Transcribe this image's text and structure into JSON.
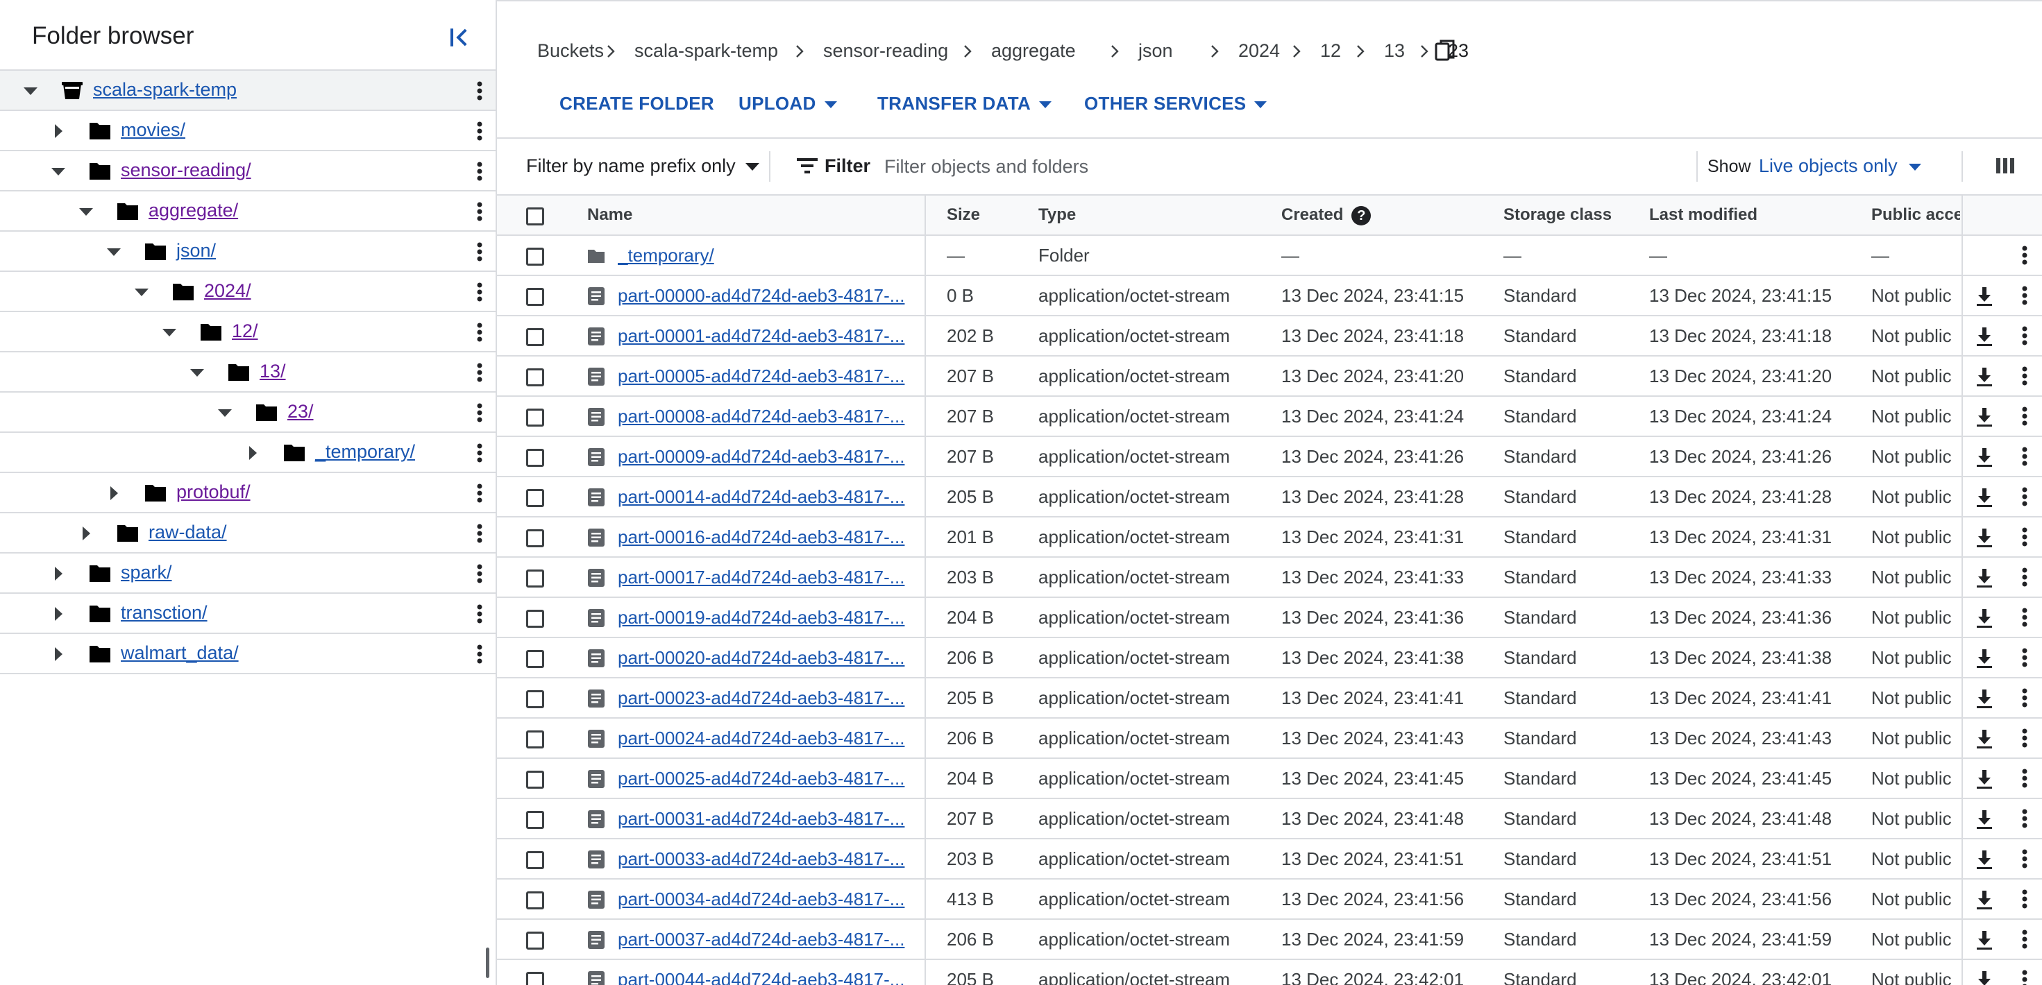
{
  "sidebar": {
    "title": "Folder browser",
    "collapse_icon": "collapse-panel-icon",
    "tree": [
      {
        "label": "scala-spark-temp",
        "depth": 0,
        "expanded": true,
        "kind": "bucket",
        "selected": true,
        "visited": false
      },
      {
        "label": "movies/",
        "depth": 1,
        "expanded": false,
        "kind": "folder",
        "visited": false
      },
      {
        "label": "sensor-reading/",
        "depth": 1,
        "expanded": true,
        "kind": "folder",
        "visited": true
      },
      {
        "label": "aggregate/",
        "depth": 2,
        "expanded": true,
        "kind": "folder",
        "visited": true
      },
      {
        "label": "json/",
        "depth": 3,
        "expanded": true,
        "kind": "folder",
        "visited": false
      },
      {
        "label": "2024/",
        "depth": 4,
        "expanded": true,
        "kind": "folder",
        "visited": true
      },
      {
        "label": "12/",
        "depth": 5,
        "expanded": true,
        "kind": "folder",
        "visited": true
      },
      {
        "label": "13/",
        "depth": 6,
        "expanded": true,
        "kind": "folder",
        "visited": true
      },
      {
        "label": "23/",
        "depth": 7,
        "expanded": true,
        "kind": "folder",
        "visited": true
      },
      {
        "label": "_temporary/",
        "depth": 8,
        "expanded": false,
        "kind": "folder",
        "visited": false
      },
      {
        "label": "protobuf/",
        "depth": 3,
        "expanded": false,
        "kind": "folder",
        "visited": true
      },
      {
        "label": "raw-data/",
        "depth": 2,
        "expanded": false,
        "kind": "folder",
        "visited": false
      },
      {
        "label": "spark/",
        "depth": 1,
        "expanded": false,
        "kind": "folder",
        "visited": false
      },
      {
        "label": "transction/",
        "depth": 1,
        "expanded": false,
        "kind": "folder",
        "visited": false
      },
      {
        "label": "walmart_data/",
        "depth": 1,
        "expanded": false,
        "kind": "folder",
        "visited": false
      }
    ]
  },
  "breadcrumb": [
    "Buckets",
    "scala-spark-temp",
    "sensor-reading",
    "aggregate",
    "json",
    "2024",
    "12",
    "13",
    "23"
  ],
  "toolbar": {
    "create_folder": "CREATE FOLDER",
    "upload": "UPLOAD",
    "transfer_data": "TRANSFER DATA",
    "other_services": "OTHER SERVICES"
  },
  "filter": {
    "prefix_mode": "Filter by name prefix only",
    "label": "Filter",
    "placeholder": "Filter objects and folders",
    "show_label": "Show",
    "show_value": "Live objects only"
  },
  "table": {
    "columns": {
      "name": "Name",
      "size": "Size",
      "type": "Type",
      "created": "Created",
      "storage_class": "Storage class",
      "last_modified": "Last modified",
      "public_access": "Public acces"
    },
    "rows": [
      {
        "kind": "folder",
        "name": "_temporary/",
        "size": "—",
        "type": "Folder",
        "created": "—",
        "storage_class": "—",
        "last_modified": "—",
        "public_access": "—"
      },
      {
        "kind": "file",
        "name": "part-00000-ad4d724d-aeb3-4817-...",
        "size": "0 B",
        "type": "application/octet-stream",
        "created": "13 Dec 2024, 23:41:15",
        "storage_class": "Standard",
        "last_modified": "13 Dec 2024, 23:41:15",
        "public_access": "Not public"
      },
      {
        "kind": "file",
        "name": "part-00001-ad4d724d-aeb3-4817-...",
        "size": "202 B",
        "type": "application/octet-stream",
        "created": "13 Dec 2024, 23:41:18",
        "storage_class": "Standard",
        "last_modified": "13 Dec 2024, 23:41:18",
        "public_access": "Not public"
      },
      {
        "kind": "file",
        "name": "part-00005-ad4d724d-aeb3-4817-...",
        "size": "207 B",
        "type": "application/octet-stream",
        "created": "13 Dec 2024, 23:41:20",
        "storage_class": "Standard",
        "last_modified": "13 Dec 2024, 23:41:20",
        "public_access": "Not public"
      },
      {
        "kind": "file",
        "name": "part-00008-ad4d724d-aeb3-4817-...",
        "size": "207 B",
        "type": "application/octet-stream",
        "created": "13 Dec 2024, 23:41:24",
        "storage_class": "Standard",
        "last_modified": "13 Dec 2024, 23:41:24",
        "public_access": "Not public"
      },
      {
        "kind": "file",
        "name": "part-00009-ad4d724d-aeb3-4817-...",
        "size": "207 B",
        "type": "application/octet-stream",
        "created": "13 Dec 2024, 23:41:26",
        "storage_class": "Standard",
        "last_modified": "13 Dec 2024, 23:41:26",
        "public_access": "Not public"
      },
      {
        "kind": "file",
        "name": "part-00014-ad4d724d-aeb3-4817-...",
        "size": "205 B",
        "type": "application/octet-stream",
        "created": "13 Dec 2024, 23:41:28",
        "storage_class": "Standard",
        "last_modified": "13 Dec 2024, 23:41:28",
        "public_access": "Not public"
      },
      {
        "kind": "file",
        "name": "part-00016-ad4d724d-aeb3-4817-...",
        "size": "201 B",
        "type": "application/octet-stream",
        "created": "13 Dec 2024, 23:41:31",
        "storage_class": "Standard",
        "last_modified": "13 Dec 2024, 23:41:31",
        "public_access": "Not public"
      },
      {
        "kind": "file",
        "name": "part-00017-ad4d724d-aeb3-4817-...",
        "size": "203 B",
        "type": "application/octet-stream",
        "created": "13 Dec 2024, 23:41:33",
        "storage_class": "Standard",
        "last_modified": "13 Dec 2024, 23:41:33",
        "public_access": "Not public"
      },
      {
        "kind": "file",
        "name": "part-00019-ad4d724d-aeb3-4817-...",
        "size": "204 B",
        "type": "application/octet-stream",
        "created": "13 Dec 2024, 23:41:36",
        "storage_class": "Standard",
        "last_modified": "13 Dec 2024, 23:41:36",
        "public_access": "Not public"
      },
      {
        "kind": "file",
        "name": "part-00020-ad4d724d-aeb3-4817-...",
        "size": "206 B",
        "type": "application/octet-stream",
        "created": "13 Dec 2024, 23:41:38",
        "storage_class": "Standard",
        "last_modified": "13 Dec 2024, 23:41:38",
        "public_access": "Not public"
      },
      {
        "kind": "file",
        "name": "part-00023-ad4d724d-aeb3-4817-...",
        "size": "205 B",
        "type": "application/octet-stream",
        "created": "13 Dec 2024, 23:41:41",
        "storage_class": "Standard",
        "last_modified": "13 Dec 2024, 23:41:41",
        "public_access": "Not public"
      },
      {
        "kind": "file",
        "name": "part-00024-ad4d724d-aeb3-4817-...",
        "size": "206 B",
        "type": "application/octet-stream",
        "created": "13 Dec 2024, 23:41:43",
        "storage_class": "Standard",
        "last_modified": "13 Dec 2024, 23:41:43",
        "public_access": "Not public"
      },
      {
        "kind": "file",
        "name": "part-00025-ad4d724d-aeb3-4817-...",
        "size": "204 B",
        "type": "application/octet-stream",
        "created": "13 Dec 2024, 23:41:45",
        "storage_class": "Standard",
        "last_modified": "13 Dec 2024, 23:41:45",
        "public_access": "Not public"
      },
      {
        "kind": "file",
        "name": "part-00031-ad4d724d-aeb3-4817-...",
        "size": "207 B",
        "type": "application/octet-stream",
        "created": "13 Dec 2024, 23:41:48",
        "storage_class": "Standard",
        "last_modified": "13 Dec 2024, 23:41:48",
        "public_access": "Not public"
      },
      {
        "kind": "file",
        "name": "part-00033-ad4d724d-aeb3-4817-...",
        "size": "203 B",
        "type": "application/octet-stream",
        "created": "13 Dec 2024, 23:41:51",
        "storage_class": "Standard",
        "last_modified": "13 Dec 2024, 23:41:51",
        "public_access": "Not public"
      },
      {
        "kind": "file",
        "name": "part-00034-ad4d724d-aeb3-4817-...",
        "size": "413 B",
        "type": "application/octet-stream",
        "created": "13 Dec 2024, 23:41:56",
        "storage_class": "Standard",
        "last_modified": "13 Dec 2024, 23:41:56",
        "public_access": "Not public"
      },
      {
        "kind": "file",
        "name": "part-00037-ad4d724d-aeb3-4817-...",
        "size": "206 B",
        "type": "application/octet-stream",
        "created": "13 Dec 2024, 23:41:59",
        "storage_class": "Standard",
        "last_modified": "13 Dec 2024, 23:41:59",
        "public_access": "Not public"
      },
      {
        "kind": "file",
        "name": "part-00044-ad4d724d-aeb3-4817-...",
        "size": "205 B",
        "type": "application/octet-stream",
        "created": "13 Dec 2024, 23:42:01",
        "storage_class": "Standard",
        "last_modified": "13 Dec 2024, 23:42:01",
        "public_access": "Not public"
      }
    ]
  },
  "icons": {
    "tree_expanded": "caret-down-icon",
    "tree_collapsed": "caret-right-icon",
    "bucket": "bucket-icon",
    "folder": "folder-icon",
    "file": "file-icon",
    "more": "more-vert-icon",
    "download": "download-icon",
    "copy": "copy-icon",
    "filter": "filter-icon",
    "columns": "column-display-icon",
    "help": "help-icon"
  },
  "colors": {
    "link": "#1a56b0",
    "visited": "#6a1b9a",
    "border": "#dadce0",
    "header_bg": "#f8f9fa",
    "selected_bg": "#f1f3f4"
  }
}
